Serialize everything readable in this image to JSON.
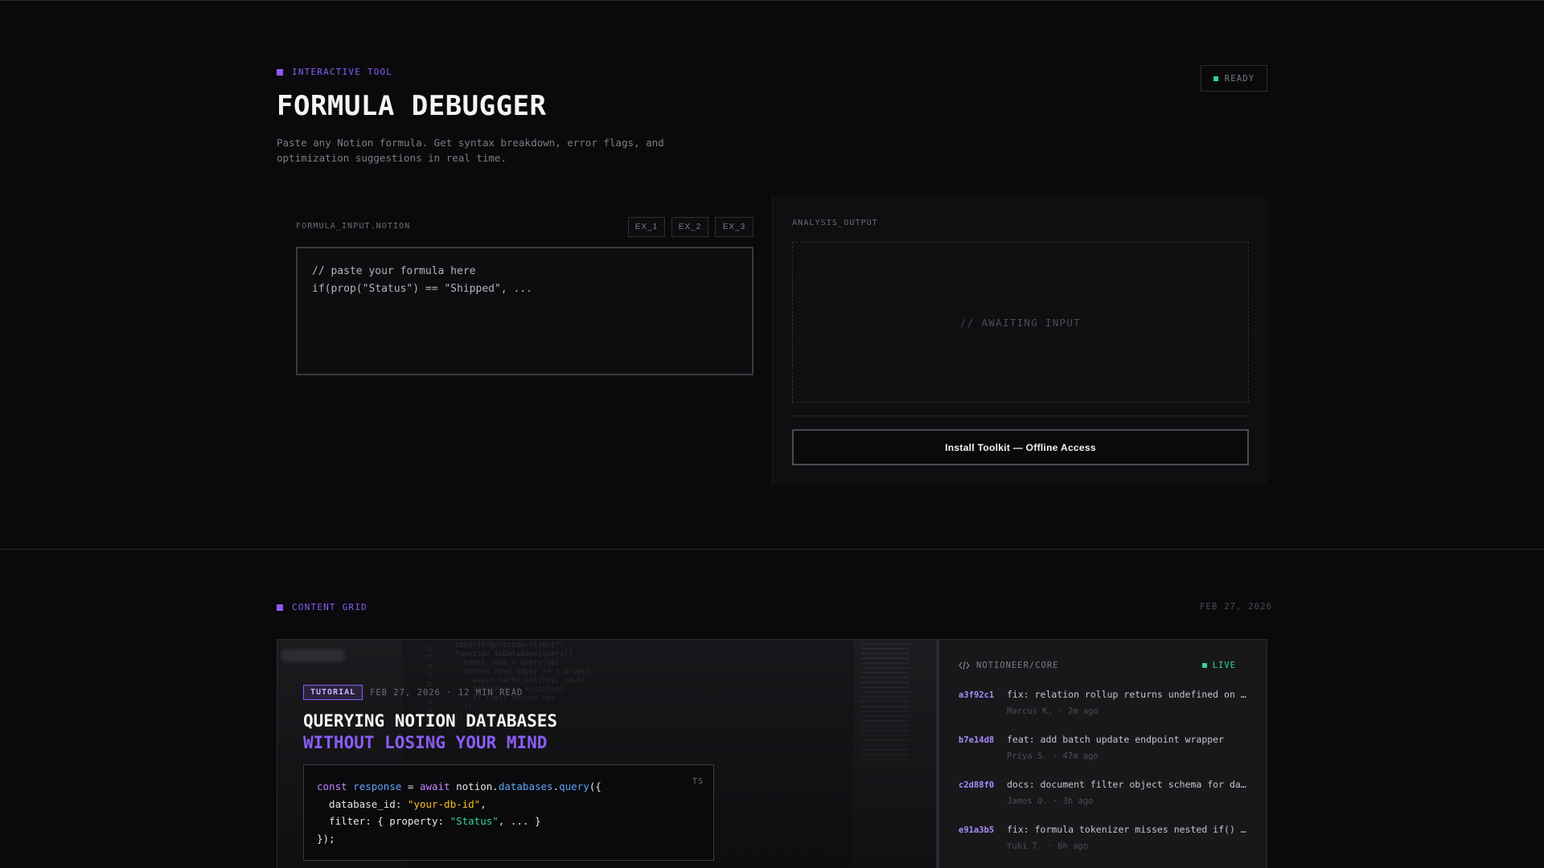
{
  "colors": {
    "accent": "#8b5cf6",
    "live": "#34d399",
    "background": "#0a0a0c"
  },
  "tool": {
    "eyebrow": "INTERACTIVE TOOL",
    "title": "FORMULA DEBUGGER",
    "subtitle": "Paste any Notion formula. Get syntax breakdown, error flags, and optimization suggestions in real time.",
    "status": "READY",
    "input_label": "FORMULA_INPUT.NOTION",
    "examples": [
      "EX_1",
      "EX_2",
      "EX_3"
    ],
    "editor_placeholder": "// paste your formula here\nif(prop(\"Status\") == \"Shipped\", ...",
    "output_label": "ANALYSIS_OUTPUT",
    "output_empty": "// AWAITING INPUT",
    "install_button": "Install Toolkit — Offline Access"
  },
  "grid": {
    "eyebrow": "CONTENT GRID",
    "date": "FEB 27, 2026",
    "card": {
      "tag": "TUTORIAL",
      "meta": "FEB 27, 2026 · 12 MIN READ",
      "title_line1": "QUERYING NOTION DATABASES",
      "title_line2": "WITHOUT LOSING YOUR MIND",
      "code_lang": "TS",
      "code": {
        "l1_kw1": "const",
        "l1_var": "response",
        "l1_op": " = ",
        "l1_kw2": "await",
        "l1_obj": " notion.",
        "l1_fn1": "databases",
        "l1_dot": ".",
        "l1_fn2": "query",
        "l1_end": "({",
        "l2_key": "  database_id: ",
        "l2_val": "\"your-db-id\"",
        "l2_end": ",",
        "l3_key": "  filter: { property: ",
        "l3_val": "\"Status\"",
        "l3_end": ", ... }",
        "l4": "});"
      }
    },
    "repo": {
      "icon": "code-icon",
      "name": "NOTIONEER/CORE",
      "live_label": "LIVE",
      "commits": [
        {
          "hash": "a3f92c1",
          "message": "fix: relation rollup returns undefined on empty arrays",
          "author": "Marcus K.",
          "time": "2m ago"
        },
        {
          "hash": "b7e14d8",
          "message": "feat: add batch update endpoint wrapper",
          "author": "Priya S.",
          "time": "47m ago"
        },
        {
          "hash": "c2d88f0",
          "message": "docs: document filter object schema for date ranges",
          "author": "James O.",
          "time": "3h ago"
        },
        {
          "hash": "e91a3b5",
          "message": "fix: formula tokenizer misses nested if() depth",
          "author": "Yuki T.",
          "time": "6h ago"
        }
      ]
    }
  }
}
